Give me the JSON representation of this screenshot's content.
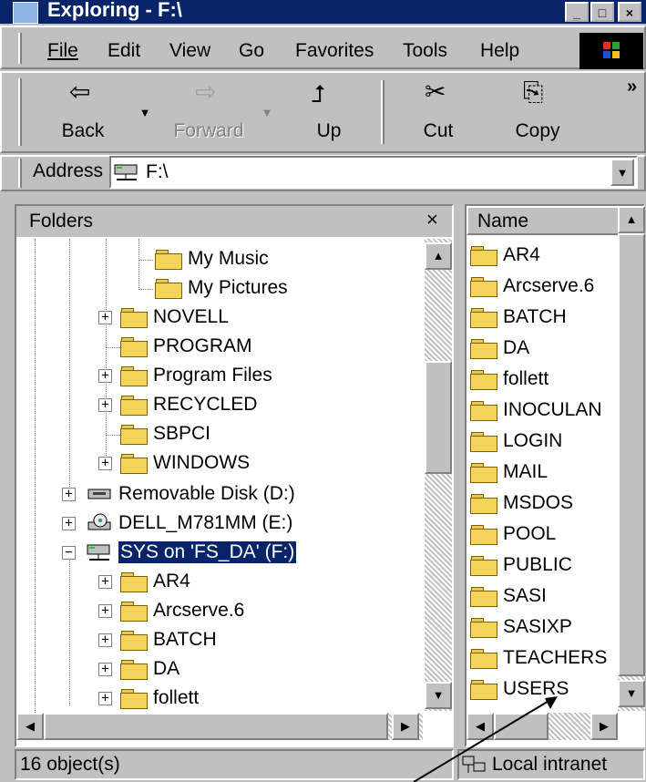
{
  "window": {
    "title": "Exploring - F:\\"
  },
  "menu": [
    {
      "label": "File"
    },
    {
      "label": "Edit"
    },
    {
      "label": "View"
    },
    {
      "label": "Go"
    },
    {
      "label": "Favorites"
    },
    {
      "label": "Tools"
    },
    {
      "label": "Help"
    }
  ],
  "toolbar": {
    "back": "Back",
    "forward": "Forward",
    "up": "Up",
    "cut": "Cut",
    "copy": "Copy",
    "more": "»"
  },
  "address": {
    "label": "Address",
    "value": "F:\\"
  },
  "folders_pane": {
    "title": "Folders",
    "close": "×",
    "items": [
      {
        "label": "My Music",
        "icon": "folder-icon"
      },
      {
        "label": "My Pictures",
        "icon": "folder-icon"
      },
      {
        "label": "NOVELL",
        "icon": "folder-icon",
        "expandable": true
      },
      {
        "label": "PROGRAM",
        "icon": "folder-icon"
      },
      {
        "label": "Program Files",
        "icon": "folder-icon",
        "expandable": true
      },
      {
        "label": "RECYCLED",
        "icon": "folder-icon",
        "expandable": true
      },
      {
        "label": "SBPCI",
        "icon": "folder-icon"
      },
      {
        "label": "WINDOWS",
        "icon": "folder-icon",
        "expandable": true
      },
      {
        "label": "Removable Disk (D:)",
        "icon": "removable-disk-icon",
        "expandable": true
      },
      {
        "label": "DELL_M781MM (E:)",
        "icon": "cd-drive-icon",
        "expandable": true
      },
      {
        "label": "SYS on 'FS_DA' (F:)",
        "icon": "network-drive-icon",
        "expanded": true,
        "selected": true
      },
      {
        "label": "AR4",
        "icon": "folder-icon",
        "expandable": true
      },
      {
        "label": "Arcserve.6",
        "icon": "folder-icon",
        "expandable": true
      },
      {
        "label": "BATCH",
        "icon": "folder-icon",
        "expandable": true
      },
      {
        "label": "DA",
        "icon": "folder-icon",
        "expandable": true
      },
      {
        "label": "follett",
        "icon": "folder-icon",
        "expandable": true
      }
    ]
  },
  "contents_pane": {
    "column_name": "Name",
    "items": [
      "AR4",
      "Arcserve.6",
      "BATCH",
      "DA",
      "follett",
      "INOCULAN",
      "LOGIN",
      "MAIL",
      "MSDOS",
      "POOL",
      "PUBLIC",
      "SASI",
      "SASIXP",
      "TEACHERS",
      "USERS"
    ]
  },
  "status": {
    "count": "16 object(s)",
    "zone": "Local intranet"
  }
}
